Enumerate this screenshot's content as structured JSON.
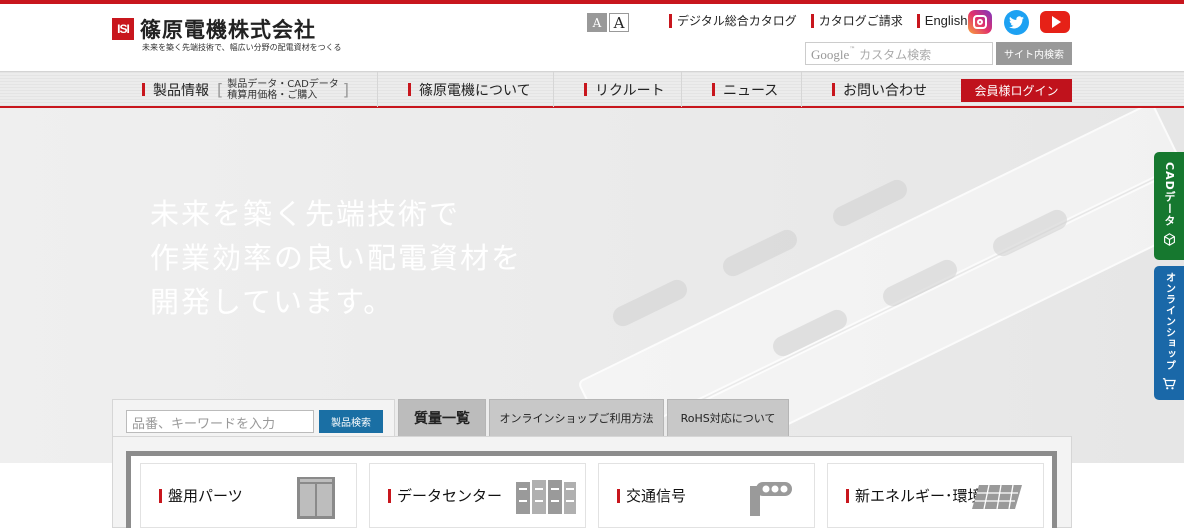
{
  "header": {
    "logo_mark": "ISI",
    "company_name": "篠原電機株式会社",
    "tagline": "未来を築く先端技術で、幅広い分野の配電資材をつくる",
    "font_small": "A",
    "font_large": "A",
    "links": [
      "デジタル総合カタログ",
      "カタログご請求",
      "English"
    ],
    "social": [
      "instagram-icon",
      "twitter-icon",
      "youtube-icon"
    ],
    "search_google": "Google",
    "search_placeholder": "カスタム検索",
    "search_button": "サイト内検索"
  },
  "nav": {
    "products": "製品情報",
    "products_sub1": "製品データ・CADデータ",
    "products_sub2": "積算用価格・ご購入",
    "about": "篠原電機について",
    "recruit": "リクルート",
    "news": "ニュース",
    "contact": "お問い合わせ",
    "login": "会員様ログイン"
  },
  "hero": {
    "line1": "未来を築く先端技術で",
    "line2": "作業効率の良い配電資材を",
    "line3": "開発しています。"
  },
  "side_tabs": {
    "cad": "CADデータ",
    "shop": "オンラインショップ"
  },
  "search": {
    "placeholder": "品番、キーワードを入力",
    "button": "製品検索"
  },
  "tabs": [
    "質量一覧",
    "オンラインショップご利用方法",
    "RoHS対応について"
  ],
  "categories": [
    "盤用パーツ",
    "データセンター",
    "交通信号",
    "新エネルギー･環境"
  ],
  "colors": {
    "brand_red": "#c8161d",
    "cad_green": "#16782f",
    "shop_blue": "#1a68a8",
    "search_blue": "#1a6fa4"
  }
}
